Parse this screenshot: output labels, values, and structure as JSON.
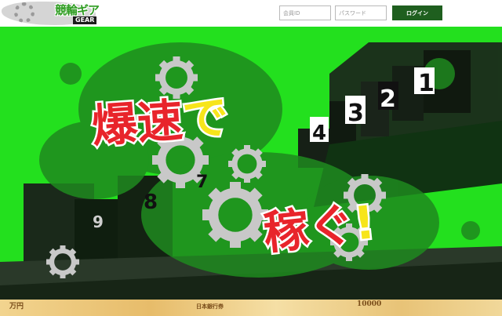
{
  "header": {
    "logo_text": "競輪ギア",
    "logo_sub": "GEAR",
    "member_id_placeholder": "会員ID",
    "password_placeholder": "パスワード",
    "login_label": "ログイン"
  },
  "hero": {
    "headline_top": "爆速で",
    "headline_bottom": "稼ぐ!",
    "gate_numbers": [
      "1",
      "2",
      "3",
      "4",
      "7",
      "8",
      "9"
    ]
  },
  "money_strip": {
    "notes": [
      "万円",
      "日本銀行券",
      "10000"
    ]
  },
  "colors": {
    "hero_green": "#23e01e",
    "dark_green": "#1f5f1f",
    "headline_red": "#e8242b",
    "headline_yellow": "#f7e51b"
  }
}
